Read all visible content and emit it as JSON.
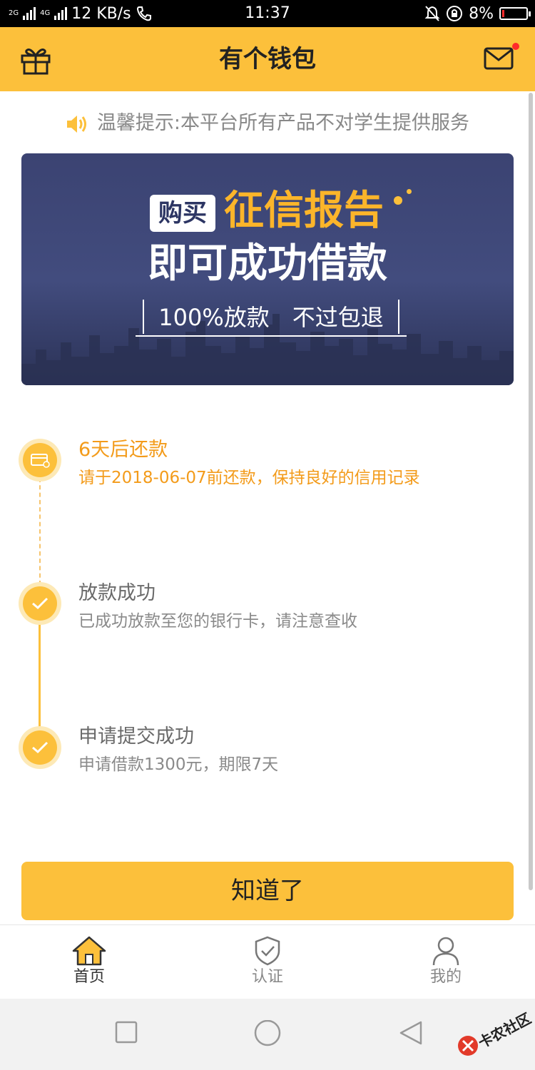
{
  "status_bar": {
    "net_label_1": "2G",
    "net_label_2": "4G",
    "speed": "12 KB/s",
    "time": "11:37",
    "battery": "8%"
  },
  "header": {
    "title": "有个钱包"
  },
  "notice": {
    "text": "温馨提示:本平台所有产品不对学生提供服务"
  },
  "banner": {
    "buy": "购买",
    "report": "征信报告",
    "loan": "即可成功借款",
    "guarantee": "100%放款　不过包退"
  },
  "timeline": [
    {
      "title": "6天后还款",
      "desc": "请于2018-06-07前还款，保持良好的信用记录",
      "state": "current"
    },
    {
      "title": "放款成功",
      "desc": "已成功放款至您的银行卡，请注意查收",
      "state": "done"
    },
    {
      "title": "申请提交成功",
      "desc": "申请借款1300元，期限7天",
      "state": "done"
    }
  ],
  "button": {
    "label": "知道了"
  },
  "tabs": [
    {
      "label": "首页",
      "icon": "home-icon",
      "active": true
    },
    {
      "label": "认证",
      "icon": "shield-check-icon",
      "active": false
    },
    {
      "label": "我的",
      "icon": "user-icon",
      "active": false
    }
  ],
  "watermark": {
    "text": "卡农社区"
  },
  "colors": {
    "accent": "#fcc03b",
    "orange_text": "#f39b1a",
    "banner_bg": "#3b4372",
    "badge_red": "#ff2a2a"
  }
}
